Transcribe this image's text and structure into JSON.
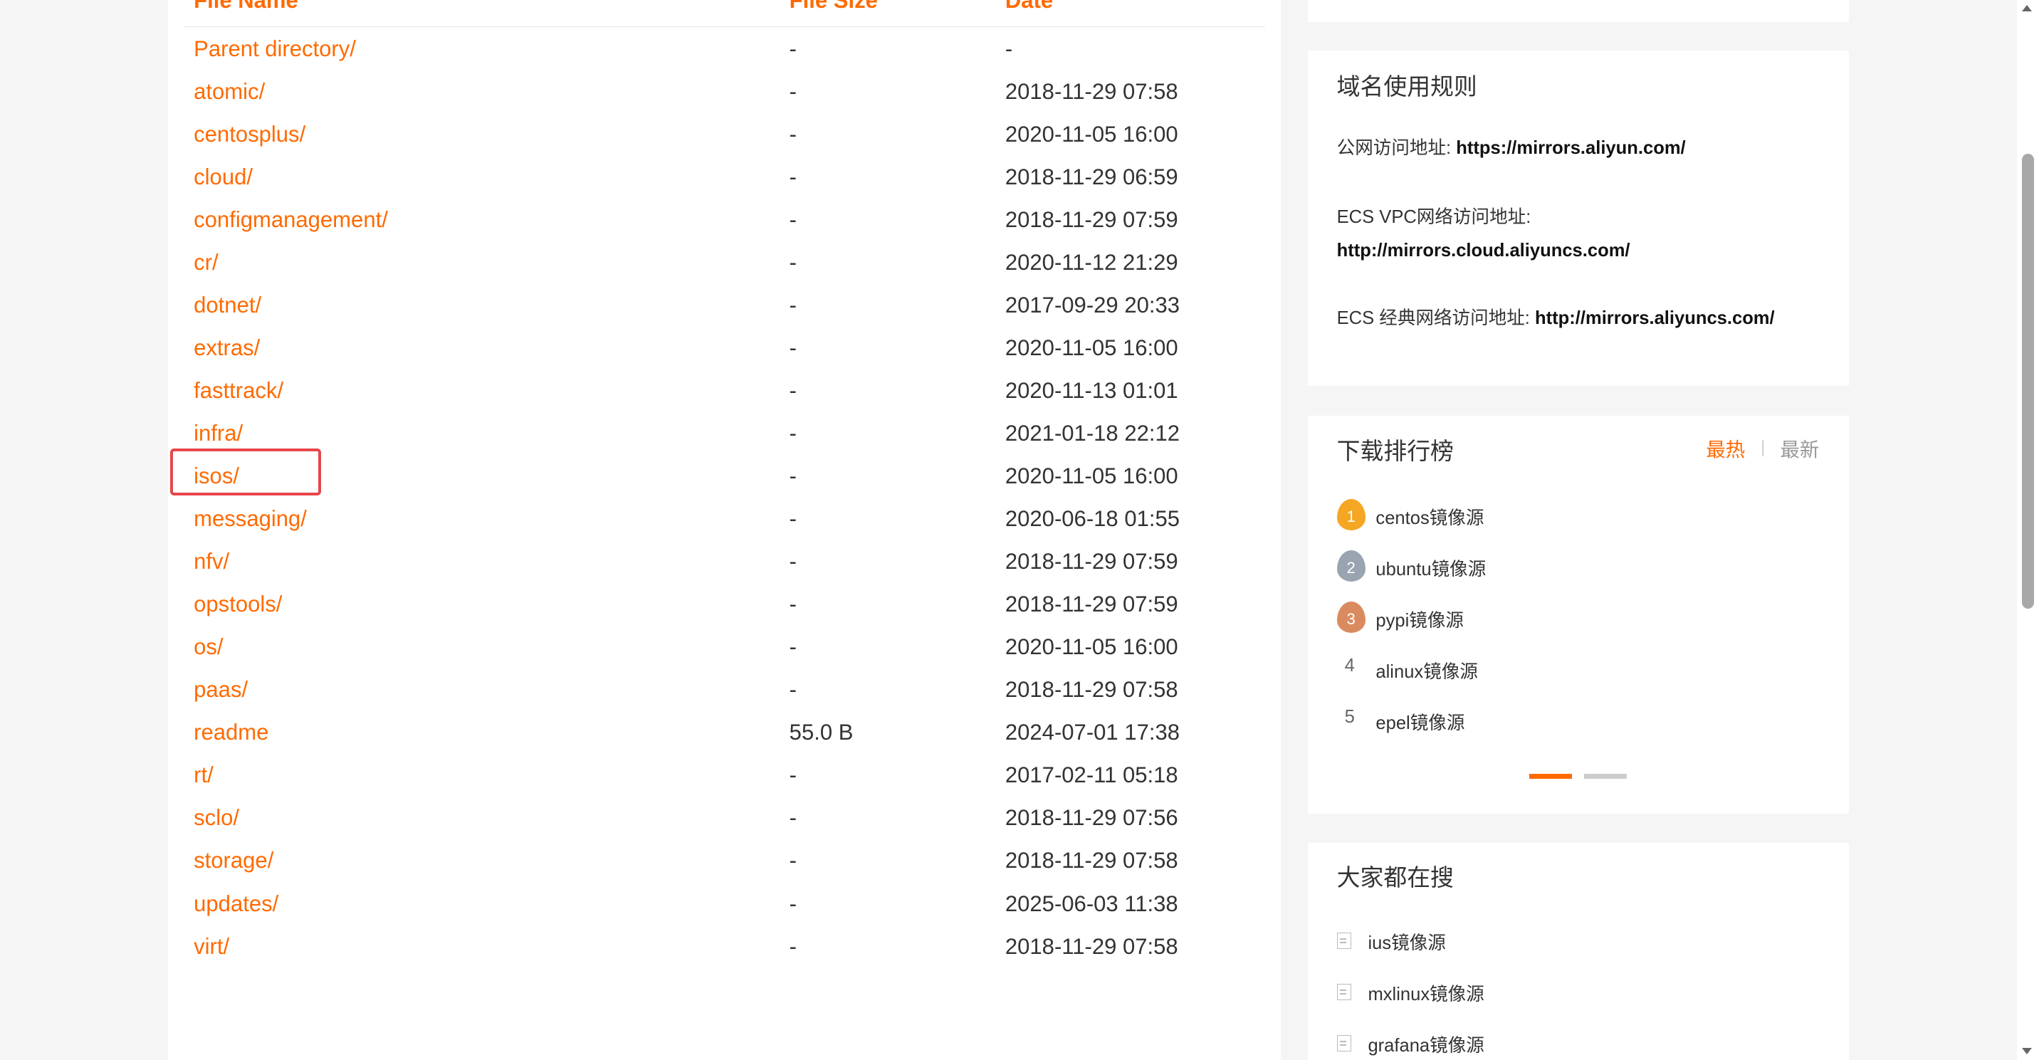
{
  "table": {
    "headers": {
      "name": "File Name",
      "size": "File Size",
      "date": "Date"
    },
    "rows": [
      {
        "name": "Parent directory/",
        "size": "-",
        "date": "-"
      },
      {
        "name": "atomic/",
        "size": "-",
        "date": "2018-11-29 07:58"
      },
      {
        "name": "centosplus/",
        "size": "-",
        "date": "2020-11-05 16:00"
      },
      {
        "name": "cloud/",
        "size": "-",
        "date": "2018-11-29 06:59"
      },
      {
        "name": "configmanagement/",
        "size": "-",
        "date": "2018-11-29 07:59"
      },
      {
        "name": "cr/",
        "size": "-",
        "date": "2020-11-12 21:29"
      },
      {
        "name": "dotnet/",
        "size": "-",
        "date": "2017-09-29 20:33"
      },
      {
        "name": "extras/",
        "size": "-",
        "date": "2020-11-05 16:00"
      },
      {
        "name": "fasttrack/",
        "size": "-",
        "date": "2020-11-13 01:01"
      },
      {
        "name": "infra/",
        "size": "-",
        "date": "2021-01-18 22:12"
      },
      {
        "name": "isos/",
        "size": "-",
        "date": "2020-11-05 16:00"
      },
      {
        "name": "messaging/",
        "size": "-",
        "date": "2020-06-18 01:55"
      },
      {
        "name": "nfv/",
        "size": "-",
        "date": "2018-11-29 07:59"
      },
      {
        "name": "opstools/",
        "size": "-",
        "date": "2018-11-29 07:59"
      },
      {
        "name": "os/",
        "size": "-",
        "date": "2020-11-05 16:00"
      },
      {
        "name": "paas/",
        "size": "-",
        "date": "2018-11-29 07:58"
      },
      {
        "name": "readme",
        "size": "55.0 B",
        "date": "2024-07-01 17:38"
      },
      {
        "name": "rt/",
        "size": "-",
        "date": "2017-02-11 05:18"
      },
      {
        "name": "sclo/",
        "size": "-",
        "date": "2018-11-29 07:56"
      },
      {
        "name": "storage/",
        "size": "-",
        "date": "2018-11-29 07:58"
      },
      {
        "name": "updates/",
        "size": "-",
        "date": "2025-06-03 11:38"
      },
      {
        "name": "virt/",
        "size": "-",
        "date": "2018-11-29 07:58"
      }
    ]
  },
  "domain_rules": {
    "title": "域名使用规则",
    "public_label": "公网访问地址: ",
    "public_url": "https://mirrors.aliyun.com/",
    "vpc_label": "ECS VPC网络访问地址:",
    "vpc_url": "http://mirrors.cloud.aliyuncs.com/",
    "classic_label": "ECS 经典网络访问地址: ",
    "classic_url": "http://mirrors.aliyuncs.com/"
  },
  "ranking": {
    "title": "下载排行榜",
    "tab_hot": "最热",
    "tab_separator": "|",
    "tab_new": "最新",
    "items": [
      {
        "rank": "1",
        "label": "centos镜像源",
        "color": "#f5a623"
      },
      {
        "rank": "2",
        "label": "ubuntu镜像源",
        "color": "#9aa4b0"
      },
      {
        "rank": "3",
        "label": "pypi镜像源",
        "color": "#d98b5f"
      },
      {
        "rank": "4",
        "label": "alinux镜像源"
      },
      {
        "rank": "5",
        "label": "epel镜像源"
      }
    ]
  },
  "popular_search": {
    "title": "大家都在搜",
    "items": [
      {
        "label": "ius镜像源"
      },
      {
        "label": "mxlinux镜像源"
      },
      {
        "label": "grafana镜像源"
      }
    ]
  },
  "colors": {
    "accent": "#ff6a00",
    "highlight": "#e8474b",
    "dot_inactive": "#cccccc"
  }
}
